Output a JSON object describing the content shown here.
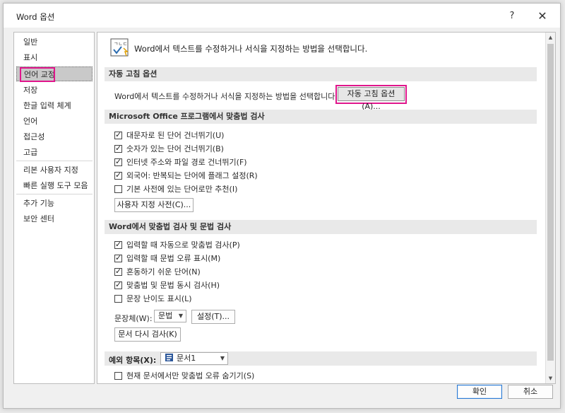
{
  "window": {
    "title": "Word 옵션",
    "help": "?",
    "close": "✕"
  },
  "sidebar": {
    "items": [
      {
        "label": "일반"
      },
      {
        "label": "표시"
      },
      {
        "label": "언어 교정",
        "selected": true
      },
      {
        "label": "저장"
      },
      {
        "label": "한글 입력 체계"
      },
      {
        "label": "언어"
      },
      {
        "label": "접근성"
      },
      {
        "label": "고급"
      },
      {
        "label": "리본 사용자 지정"
      },
      {
        "label": "빠른 실행 도구 모음"
      },
      {
        "label": "추가 기능"
      },
      {
        "label": "보안 센터"
      }
    ]
  },
  "main": {
    "header": "Word에서 텍스트를 수정하거나 서식을 지정하는 방법을 선택합니다.",
    "autocorrect": {
      "title": "자동 고침 옵션",
      "description": "Word에서 텍스트를 수정하거나 서식을 지정하는 방법을 선택합니다.",
      "button": "자동 고침 옵션(A)..."
    },
    "office": {
      "title": "Microsoft Office 프로그램에서 맞춤법 검사",
      "checkboxes": [
        {
          "label": "대문자로 된 단어 건너뛰기(U)",
          "checked": true
        },
        {
          "label": "숫자가 있는 단어 건너뛰기(B)",
          "checked": true
        },
        {
          "label": "인터넷 주소와 파일 경로 건너뛰기(F)",
          "checked": true
        },
        {
          "label": "외국어: 반복되는 단어에 플래그 설정(R)",
          "checked": true
        },
        {
          "label": "기본 사전에 있는 단어로만 추천(I)",
          "checked": false
        }
      ],
      "custom_dict_button": "사용자 지정 사전(C)..."
    },
    "word": {
      "title": "Word에서 맞춤법 검사 및 문법 검사",
      "checkboxes": [
        {
          "label": "입력할 때 자동으로 맞춤법 검사(P)",
          "checked": true
        },
        {
          "label": "입력할 때 문법 오류 표시(M)",
          "checked": true
        },
        {
          "label": "혼동하기 쉬운 단어(N)",
          "checked": true
        },
        {
          "label": "맞춤법 및 문법 동시 검사(H)",
          "checked": true
        },
        {
          "label": "문장 난이도 표시(L)",
          "checked": false
        }
      ],
      "style_label": "문장체(W):",
      "style_value": "문법",
      "settings_button": "설정(T)...",
      "recheck_button": "문서 다시 검사(K)"
    },
    "exceptions": {
      "label": "예외 항목(X):",
      "document": "문서1",
      "hide_errors": {
        "label": "현재 문서에서만 맞춤법 오류 숨기기(S)",
        "checked": false
      }
    }
  },
  "footer": {
    "ok": "확인",
    "cancel": "취소"
  },
  "colors": {
    "highlight": "#e0168c",
    "selected_nav": "#c9c9c9",
    "section_bg": "#e9e9e9"
  },
  "icons": [
    "abc-check-icon",
    "help-icon",
    "close-icon",
    "document-icon",
    "chevron-down-icon"
  ]
}
